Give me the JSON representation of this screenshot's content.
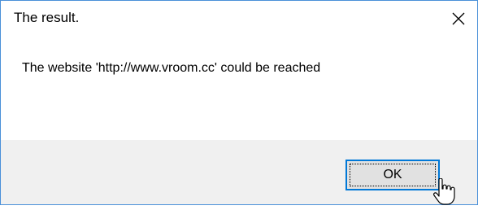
{
  "dialog": {
    "title": "The result.",
    "message": "The website 'http://www.vroom.cc' could be reached",
    "ok_label": "OK",
    "close_icon": "close-icon",
    "cursor_icon": "hand-pointer-icon"
  },
  "colors": {
    "window_border": "#4a90d9",
    "footer_background": "#f0f0f0",
    "button_focus_border": "#0078d7",
    "button_background": "#e1e1e1"
  }
}
